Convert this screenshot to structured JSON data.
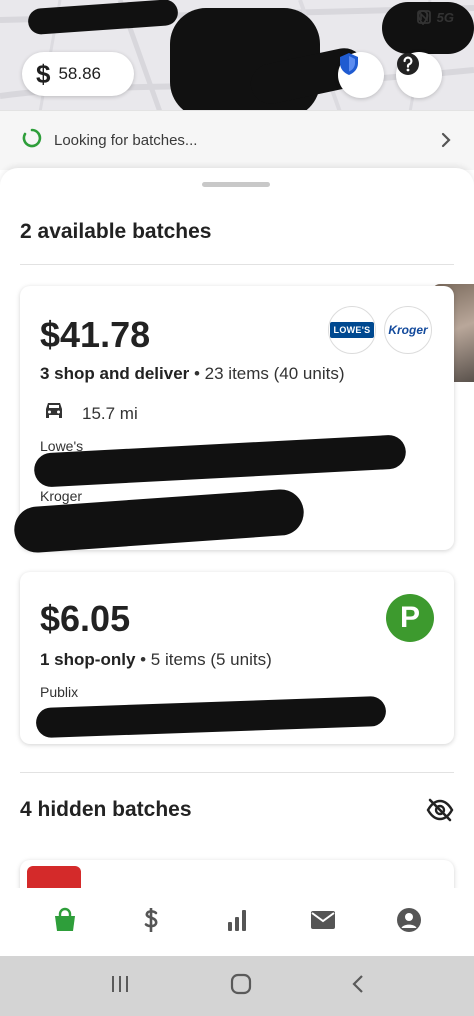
{
  "status_bar": {
    "network": "5G"
  },
  "header": {
    "earnings_symbol": "$",
    "earnings_amount": "58.86"
  },
  "looking": {
    "label": "Looking for batches..."
  },
  "available": {
    "title": "2 available batches"
  },
  "batches": [
    {
      "price": "$41.78",
      "type": "3 shop and deliver",
      "detail": " • 23 items (40 units)",
      "distance": "15.7 mi",
      "stores": [
        "Lowe's",
        "Kroger"
      ],
      "logos": [
        "LOWE'S",
        "Kroger"
      ]
    },
    {
      "price": "$6.05",
      "type": "1 shop-only",
      "detail": " • 5 items (5 units)",
      "stores": [
        "Publix"
      ],
      "logos": [
        "P"
      ]
    }
  ],
  "hidden": {
    "title": "4 hidden batches"
  },
  "colors": {
    "accent_green": "#2e9e3a",
    "publix_green": "#3d9a2e",
    "lowes_blue": "#004990",
    "kroger_blue": "#134a9c",
    "thumb_red": "#d42a2a"
  },
  "icons": [
    "location-icon",
    "shield-icon",
    "help-icon",
    "spinner-icon",
    "chevron-right-icon",
    "car-icon",
    "eye-off-icon",
    "bag-icon",
    "dollar-icon",
    "bar-chart-icon",
    "mail-icon",
    "account-icon",
    "recents-icon",
    "home-icon",
    "back-icon"
  ]
}
